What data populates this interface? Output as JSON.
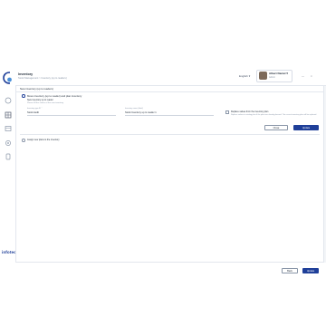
{
  "app": {
    "title": "Inventory",
    "breadcrumb": "Stock Management  >  Inventory (up to readers)",
    "language": "English",
    "language_caret": "▾"
  },
  "user": {
    "name": "Albert Daniel",
    "role": "Admin",
    "caret": "▾"
  },
  "window": {
    "minimize": "—",
    "close": "×"
  },
  "section": {
    "title": "New inventory (up to readers)"
  },
  "option1": {
    "label": "Move inventory (up to reader) and plan inventory",
    "sub_label": "New inventory up to reader",
    "hint": "Please fill the values of the new inventory",
    "field1_label": "Inventory type ID *",
    "field1_value": "Stock Audit",
    "field2_label": "Inventory name (label)",
    "field2_value": "Stock Inventory up to reader 1"
  },
  "right_option": {
    "label": "Replace values from the inventory plan",
    "hint": "Replace values in existing plan if the plan was already planned. The current inventory plan will be replaced."
  },
  "inner_buttons": {
    "cancel": "Close",
    "confirm": "Update"
  },
  "option2": {
    "label": "Assign new plans to the inventory"
  },
  "brand": "infotec",
  "footer_buttons": {
    "back": "Back",
    "next": "Update"
  },
  "colors": {
    "primary": "#1f3f99",
    "border": "#e3e7ee",
    "muted": "#8a96a8"
  }
}
